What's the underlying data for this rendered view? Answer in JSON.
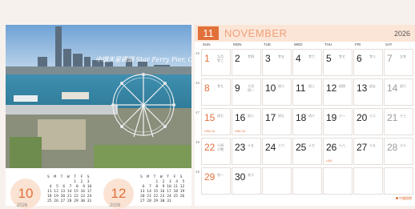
{
  "photo": {
    "caption": "中環天星碼頭 Star Ferry Pier, Central"
  },
  "mini_calendars": [
    {
      "month": "10",
      "year": "2026",
      "grid": "S  M  T  W  T  F  S\n            1  2  3\n 4  5  6  7  8  9 10\n11 12 13 14 15 16 17\n18 19 20 21 22 23 24\n25 26 27 28 29 30 31"
    },
    {
      "month": "12",
      "year": "2026",
      "grid": "S  M  T  W  T  F  S\n       1  2  3  4  5\n 6  7  8  9 10 11 12\n13 14 15 16 17 18 19\n20 21 22 23 24 25 26\n27 28 29 30 31"
    }
  ],
  "month": {
    "number": "11",
    "name": "NOVEMBER",
    "year": "2026"
  },
  "weekdays": [
    "SUN",
    "MON",
    "TUE",
    "WED",
    "THU",
    "FRI",
    "SAT"
  ],
  "weeks": [
    {
      "wk": "45",
      "days": [
        {
          "n": "1",
          "l": "九月\n廿三"
        },
        {
          "n": "2",
          "l": "廿四"
        },
        {
          "n": "3",
          "l": "廿五"
        },
        {
          "n": "4",
          "l": "廿六"
        },
        {
          "n": "5",
          "l": "廿七"
        },
        {
          "n": "6",
          "l": "廿八"
        },
        {
          "n": "7",
          "l": "立冬"
        }
      ]
    },
    {
      "wk": "46",
      "days": [
        {
          "n": "8",
          "l": "廿九"
        },
        {
          "n": "9",
          "l": "十月\n初一"
        },
        {
          "n": "10",
          "l": "初二"
        },
        {
          "n": "11",
          "l": "初三"
        },
        {
          "n": "12",
          "l": "初四"
        },
        {
          "n": "13",
          "l": "初五"
        },
        {
          "n": "14",
          "l": "初六"
        }
      ]
    },
    {
      "wk": "47",
      "days": [
        {
          "n": "15",
          "l": "初七",
          "h": "USA CA"
        },
        {
          "n": "16",
          "l": "初八",
          "h": "USA CA"
        },
        {
          "n": "17",
          "l": "初九"
        },
        {
          "n": "18",
          "l": "初十"
        },
        {
          "n": "19",
          "l": "十一"
        },
        {
          "n": "20",
          "l": "十二"
        },
        {
          "n": "21",
          "l": "十三"
        }
      ]
    },
    {
      "wk": "48",
      "days": [
        {
          "n": "22",
          "l": "十四\n小雪"
        },
        {
          "n": "23",
          "l": "十五"
        },
        {
          "n": "24",
          "l": "十六"
        },
        {
          "n": "25",
          "l": "十七"
        },
        {
          "n": "26",
          "l": "十八",
          "h": "USA"
        },
        {
          "n": "27",
          "l": "十九"
        },
        {
          "n": "28",
          "l": "二十"
        }
      ]
    },
    {
      "wk": "49",
      "days": [
        {
          "n": "29",
          "l": "廿一"
        },
        {
          "n": "30",
          "l": "廿二"
        },
        {
          "n": "",
          "l": ""
        },
        {
          "n": "",
          "l": ""
        },
        {
          "n": "",
          "l": ""
        },
        {
          "n": "",
          "l": ""
        },
        {
          "n": "",
          "l": ""
        }
      ]
    }
  ],
  "legend": "中國假期",
  "colors": {
    "accent": "#e2703a",
    "header_bg": "#fbe5d6"
  }
}
